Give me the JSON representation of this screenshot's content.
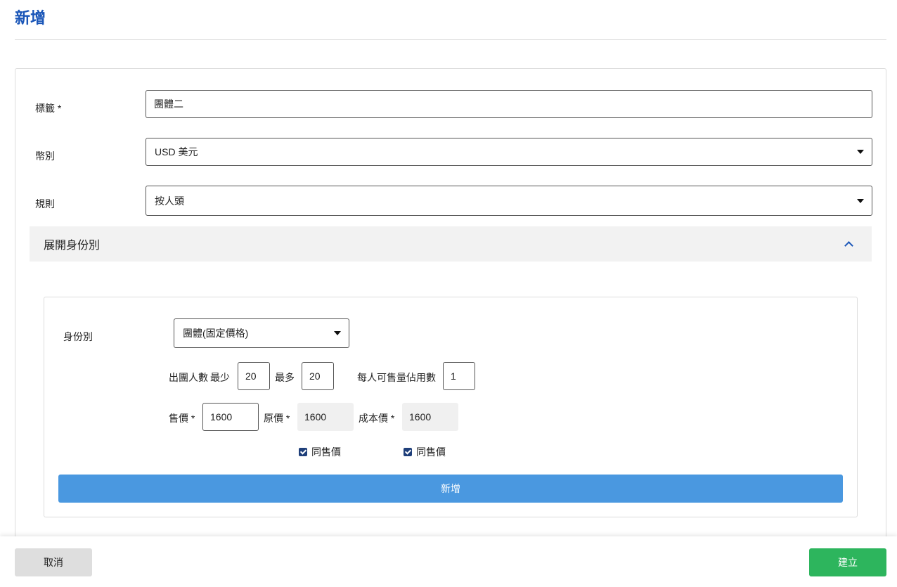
{
  "page": {
    "title": "新增"
  },
  "form": {
    "tag": {
      "label": "標籤 *",
      "value": "團體二"
    },
    "currency": {
      "label": "幣別",
      "value": "USD 美元"
    },
    "rule": {
      "label": "規則",
      "value": "按人頭"
    }
  },
  "accordion": {
    "title": "展開身份別",
    "expanded": true
  },
  "identity": {
    "label": "身份別",
    "value": "團體(固定價格)",
    "group_size_label": "出團人數",
    "min_label": "最少",
    "min_value": "20",
    "max_label": "最多",
    "max_value": "20",
    "per_person_label": "每人可售量佔用數",
    "per_person_value": "1",
    "sale_price_label": "售價 *",
    "sale_price_value": "1600",
    "original_price_label": "原價 *",
    "original_price_value": "1600",
    "cost_price_label": "成本價 *",
    "cost_price_value": "1600",
    "same_as_sale_label_1": "同售價",
    "same_as_sale_checked_1": true,
    "same_as_sale_label_2": "同售價",
    "same_as_sale_checked_2": true,
    "add_button_label": "新增"
  },
  "footer": {
    "cancel_label": "取消",
    "create_label": "建立"
  },
  "colors": {
    "primary": "#1a56b8",
    "add_button": "#4a98e0",
    "create_button": "#2db55d",
    "cancel_button": "#dedede"
  }
}
